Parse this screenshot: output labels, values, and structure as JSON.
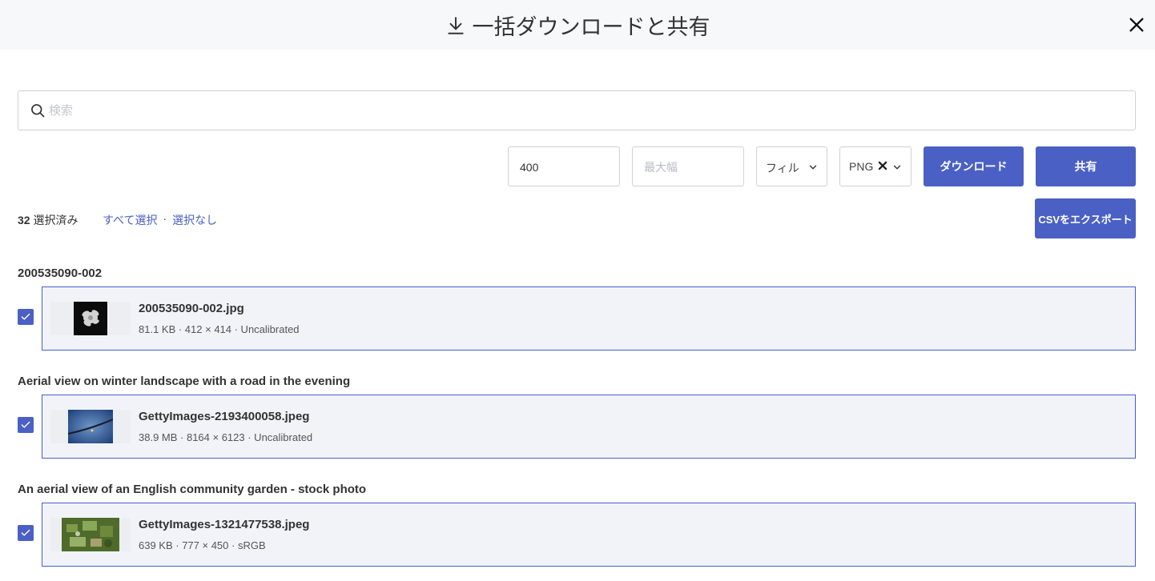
{
  "header": {
    "title": "一括ダウンロードと共有"
  },
  "search": {
    "placeholder": "検索"
  },
  "controls": {
    "width_value": "400",
    "max_width_placeholder": "最大幅",
    "fit_value": "フィル",
    "format_value": "PNG",
    "download_label": "ダウンロード",
    "share_label": "共有",
    "csv_label": "CSVをエクスポート"
  },
  "selection": {
    "count": "32",
    "count_label": "選択済み",
    "select_all": "すべて選択",
    "separator": "·",
    "select_none": "選択なし"
  },
  "groups": [
    {
      "title": "200535090-002",
      "file": {
        "name": "200535090-002.jpg",
        "meta": "81.1 KB · 412 × 414 · Uncalibrated"
      }
    },
    {
      "title": "Aerial view on winter landscape with a road in the evening",
      "file": {
        "name": "GettyImages-2193400058.jpeg",
        "meta": "38.9 MB · 8164 × 6123 · Uncalibrated"
      }
    },
    {
      "title": "An aerial view of an English community garden - stock photo",
      "file": {
        "name": "GettyImages-1321477538.jpeg",
        "meta": "639 KB · 777 × 450 · sRGB"
      }
    }
  ],
  "colors": {
    "accent": "#4a60c4",
    "header_bg": "#f7f8fa",
    "card_bg": "#f1f3f9"
  },
  "icons": {
    "title": "download-icon",
    "close": "close-icon",
    "search": "search-icon",
    "dropdown": "chevron-down-icon",
    "clear": "x-icon",
    "check": "checkmark-icon"
  }
}
